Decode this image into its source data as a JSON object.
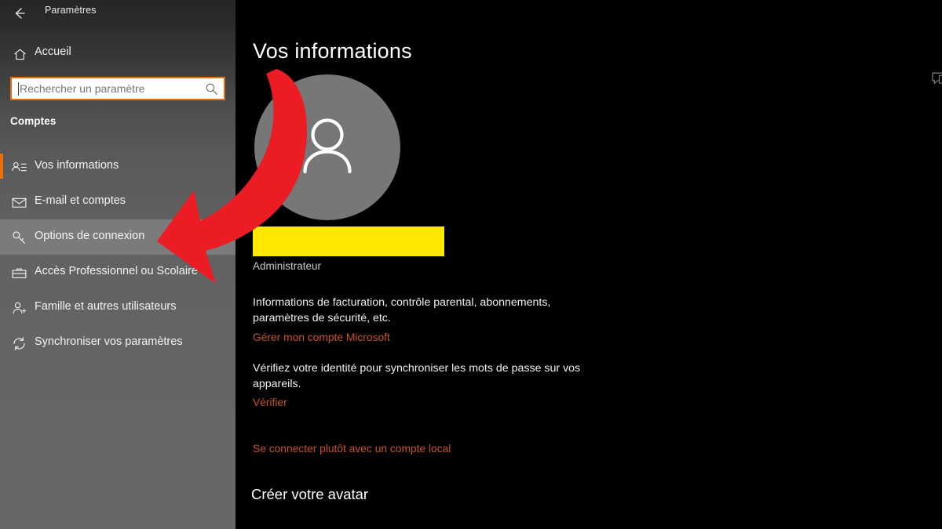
{
  "window": {
    "title": "Paramètres",
    "back_icon": "back-arrow-icon"
  },
  "sidebar": {
    "home": {
      "label": "Accueil",
      "icon": "home-icon"
    },
    "search": {
      "placeholder": "Rechercher un paramètre",
      "value": "",
      "icon": "search-icon",
      "border_color": "#e8700a"
    },
    "section_heading": "Comptes",
    "items": [
      {
        "label": "Vos informations",
        "icon": "contact-card-icon",
        "selected": true,
        "hovered": false
      },
      {
        "label": "E-mail et comptes",
        "icon": "envelope-icon",
        "selected": false,
        "hovered": false
      },
      {
        "label": "Options de connexion",
        "icon": "key-icon",
        "selected": false,
        "hovered": true
      },
      {
        "label": "Accès Professionnel ou Scolaire",
        "icon": "briefcase-icon",
        "selected": false,
        "hovered": false
      },
      {
        "label": "Famille et autres utilisateurs",
        "icon": "person-add-icon",
        "selected": false,
        "hovered": false
      },
      {
        "label": "Synchroniser vos paramètres",
        "icon": "sync-icon",
        "selected": false,
        "hovered": false
      }
    ]
  },
  "main": {
    "page_title": "Vos informations",
    "avatar_icon": "user-avatar-icon",
    "account_name_redacted": "",
    "role": "Administrateur",
    "billing_text": "Informations de facturation, contrôle parental, abonnements, paramètres de sécurité, etc.",
    "manage_account_link": "Gérer mon compte Microsoft",
    "verify_text": "Vérifiez votre identité pour synchroniser les mots de passe sur vos appareils.",
    "verify_link": "Vérifier",
    "local_account_link": "Se connecter plutôt avec un compte local",
    "avatar_section_heading": "Créer votre avatar",
    "feedback_icon": "feedback-bubble-icon"
  },
  "annotation": {
    "arrow_icon": "red-curved-arrow-annotation",
    "arrow_color": "#ec1c24",
    "points_to": "Options de connexion"
  },
  "colors": {
    "accent": "#e8700a",
    "link": "#c8502a",
    "redaction": "#ffe800",
    "avatar_bg": "#777777",
    "background": "#000000"
  }
}
